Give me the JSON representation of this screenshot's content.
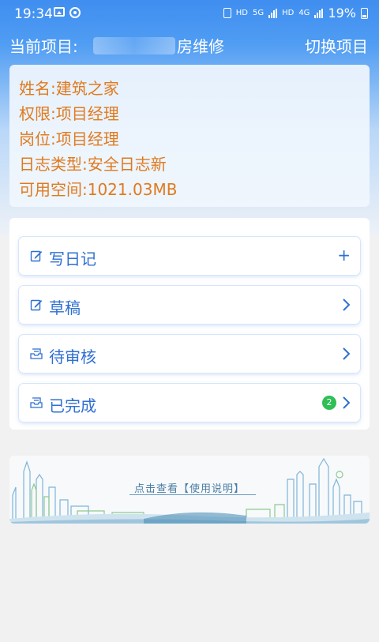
{
  "status_bar": {
    "time": "19:34",
    "battery_percent": "19%",
    "net_labels": [
      "HD",
      "5G",
      "HD",
      "4G"
    ]
  },
  "header": {
    "project_label": "当前项目:",
    "project_name": "房维修",
    "switch_label": "切换项目"
  },
  "info": {
    "name": "姓名:建筑之家",
    "permission": "权限:项目经理",
    "position": "岗位:项目经理",
    "log_type": "日志类型:安全日志新",
    "space": "可用空间:1021.03MB"
  },
  "menu": {
    "items": [
      {
        "label": "写日记",
        "icon": "edit-icon",
        "action": "+"
      },
      {
        "label": "草稿",
        "icon": "edit-icon",
        "action": "chevron-right-icon"
      },
      {
        "label": "待审核",
        "icon": "inbox-icon",
        "action": "chevron-right-icon"
      },
      {
        "label": "已完成",
        "icon": "inbox-icon",
        "action": "chevron-right-icon",
        "badge": "2"
      }
    ]
  },
  "banner": {
    "link_text": "点击查看【使用说明】"
  },
  "colors": {
    "accent": "#2f6fd2",
    "info_text": "#e07a1f",
    "badge": "#2fbf55",
    "header_blue": "#3f8ef0"
  }
}
